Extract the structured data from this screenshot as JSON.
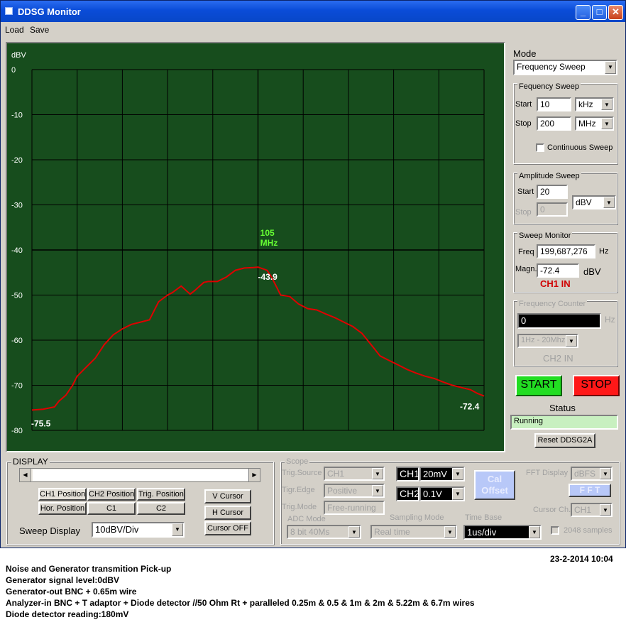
{
  "window": {
    "title": "DDSG Monitor",
    "minimize_glyph": "_",
    "maximize_glyph": "□",
    "close_glyph": "✕"
  },
  "menu": {
    "load": "Load",
    "save": "Save"
  },
  "plot": {
    "unit_label": "dBV",
    "marker_freq": "105",
    "marker_unit": "MHz",
    "marker_value": "-43.9",
    "start_label": "-75.5",
    "end_label": "-72.4",
    "colors": {
      "background": "#174d1d",
      "trace": "#e00000",
      "grid": "#000000",
      "marker": "#66ff33"
    }
  },
  "chart_data": {
    "type": "line",
    "title": "",
    "xlabel": "",
    "ylabel": "dBV",
    "ylim": [
      -80,
      0
    ],
    "y_ticks": [
      "0",
      "-10",
      "-20",
      "-30",
      "-40",
      "-50",
      "-60",
      "-70",
      "-80"
    ],
    "xlim": [
      0,
      10
    ],
    "grid": true,
    "series": [
      {
        "x": [
          0,
          0.25,
          0.5,
          0.6,
          0.75,
          0.9,
          1.0,
          1.2,
          1.4,
          1.6,
          1.8,
          2.0,
          2.2,
          2.4,
          2.6,
          2.8,
          3.0,
          3.1,
          3.3,
          3.5,
          3.6,
          3.8,
          3.9,
          4.1,
          4.3,
          4.5,
          4.7,
          4.9,
          5.0,
          5.2,
          5.3,
          5.5,
          5.7,
          5.9,
          6.1,
          6.3,
          6.5,
          6.7,
          6.9,
          7.1,
          7.3,
          7.5,
          7.7,
          7.9,
          8.1,
          8.3,
          8.5,
          8.7,
          8.9,
          9.1,
          9.3,
          9.5,
          9.7,
          9.85,
          10
        ],
        "y": [
          -75.5,
          -75.3,
          -74.8,
          -73.5,
          -72.2,
          -70.0,
          -68.0,
          -66.0,
          -64.0,
          -61.0,
          -58.8,
          -57.5,
          -56.5,
          -56.0,
          -55.5,
          -51.5,
          -50.0,
          -49.5,
          -48.0,
          -49.8,
          -49.0,
          -47.2,
          -47.0,
          -47.0,
          -46.0,
          -44.5,
          -44.0,
          -43.9,
          -43.8,
          -44.5,
          -46.0,
          -50.0,
          -50.3,
          -52.0,
          -53.0,
          -53.3,
          -54.2,
          -55.0,
          -56.0,
          -57.0,
          -58.5,
          -61.0,
          -63.5,
          -64.5,
          -65.5,
          -66.5,
          -67.3,
          -68.0,
          -68.5,
          -69.3,
          -70.0,
          -70.5,
          -71.0,
          -71.8,
          -72.4
        ]
      }
    ]
  },
  "mode": {
    "title": "Mode",
    "value": "Frequency Sweep"
  },
  "freq_sweep": {
    "title": "Fequency Sweep",
    "start_label": "Start",
    "start_value": "10",
    "start_unit": "kHz",
    "stop_label": "Stop",
    "stop_value": "200",
    "stop_unit": "MHz",
    "continuous_label": "Continuous Sweep"
  },
  "amp_sweep": {
    "title": "Amplitude Sweep",
    "start_label": "Start",
    "start_value": "20",
    "stop_label": "Stop",
    "stop_value": "0",
    "unit": "dBV"
  },
  "sweep_monitor": {
    "title": "Sweep Monitor",
    "freq_label": "Freq",
    "freq_value": "199,687,276",
    "freq_unit": "Hz",
    "magn_label": "Magn.",
    "magn_value": "-72.4",
    "magn_unit": "dBV",
    "channel": "CH1 IN"
  },
  "freq_counter": {
    "title": "Frequency Counter",
    "value": "0",
    "unit": "Hz",
    "range": "1Hz - 20Mhz",
    "channel": "CH2 IN"
  },
  "controls": {
    "start": "START",
    "stop": "STOP",
    "status_label": "Status",
    "status_value": "Running",
    "reset": "Reset DDSG2A"
  },
  "display": {
    "title": "DISPLAY",
    "buttons": [
      "CH1 Position",
      "CH2 Position",
      "Trig. Position",
      "Hor. Position",
      "C1",
      "C2"
    ],
    "v_cursor": "V Cursor",
    "h_cursor": "H Cursor",
    "cursor_off": "Cursor OFF",
    "sweep_display_label": "Sweep Display",
    "sweep_display_value": "10dBV/Div"
  },
  "scope": {
    "title": "Scope",
    "trig_source_label": "Trig.Source",
    "trig_source_value": "CH1",
    "trig_edge_label": "Tigr.Edge",
    "trig_edge_value": "Positive",
    "trig_mode_label": "Trig.Mode",
    "trig_mode_value": "Free-running",
    "ch1_label": "CH1",
    "ch1_value": "20mV",
    "ch2_label": "CH2",
    "ch2_value": "0.1V",
    "cal_offset_1": "Cal",
    "cal_offset_2": "Offset",
    "fft_display_label": "FFT Display",
    "fft_display_value": "dBFS",
    "fft_button": "F F T",
    "cursor_ch_label": "Cursor Ch.",
    "cursor_ch_value": "CH1",
    "adc_mode_label": "ADC Mode",
    "adc_mode_value": "8 bit 40Ms",
    "sampling_mode_label": "Sampling Mode",
    "sampling_mode_value": "Real time",
    "time_base_label": "Time Base",
    "time_base_value": "1us/div",
    "samples_label": "2048 samples"
  },
  "footer": {
    "timestamp": "23-2-2014 10:04",
    "lines": [
      "Noise  and Generator transmition Pick-up",
      "Generator signal level:0dBV",
      "Generator-out BNC + 0.65m wire",
      "Analyzer-in BNC + T adaptor + Diode detector //50 Ohm Rt + paralleled 0.25m & 0.5 & 1m & 2m & 5.22m & 6.7m wires",
      "Diode detector reading:180mV"
    ]
  }
}
